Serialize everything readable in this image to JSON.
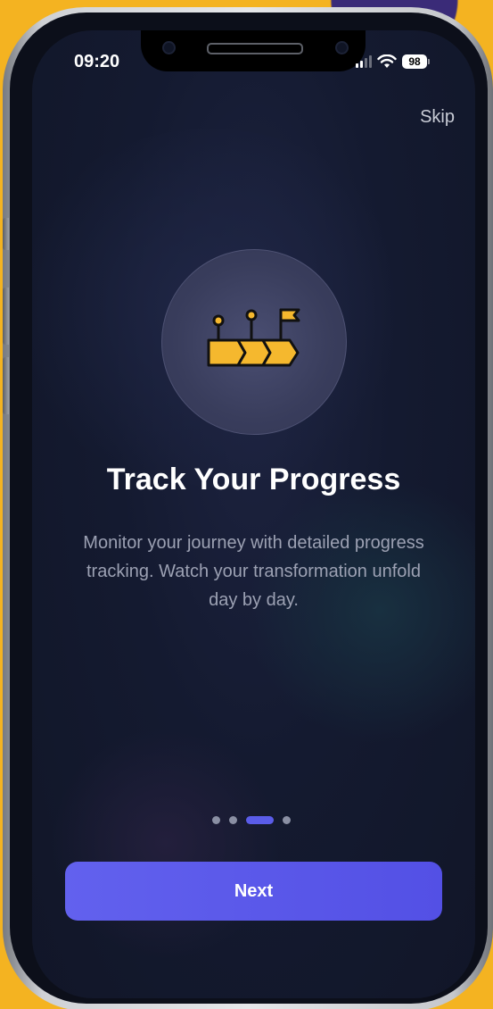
{
  "status_bar": {
    "time": "09:20",
    "battery": "98"
  },
  "header": {
    "skip_label": "Skip"
  },
  "onboarding": {
    "icon": "progress-milestone-icon",
    "title": "Track Your Progress",
    "description": "Monitor your journey with detailed progress tracking. Watch your transformation unfold day by day.",
    "page_count": 4,
    "current_page": 3
  },
  "footer": {
    "next_label": "Next"
  },
  "colors": {
    "accent": "#5a5ce8",
    "icon_yellow": "#f5b82e",
    "background": "#141a30"
  }
}
